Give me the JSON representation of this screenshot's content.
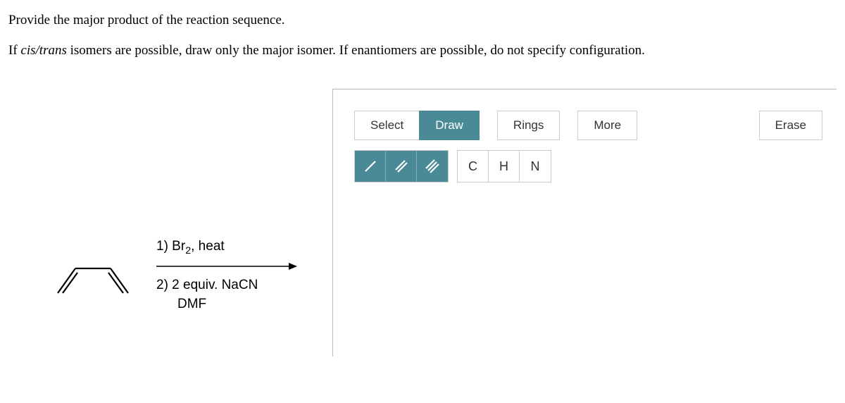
{
  "question": {
    "line1": "Provide the major product of the reaction sequence.",
    "line2_prefix": "If ",
    "line2_italic": "cis/trans",
    "line2_suffix": " isomers are possible, draw only the major isomer. If enantiomers are possible, do not specify configuration."
  },
  "reaction": {
    "step1_prefix": "1) Br",
    "step1_sub": "2",
    "step1_suffix": ", heat",
    "step2": "2) 2 equiv. NaCN",
    "step2_line2": "DMF"
  },
  "toolbar": {
    "select": "Select",
    "draw": "Draw",
    "rings": "Rings",
    "more": "More",
    "erase": "Erase"
  },
  "atoms": {
    "c": "C",
    "h": "H",
    "n": "N"
  }
}
